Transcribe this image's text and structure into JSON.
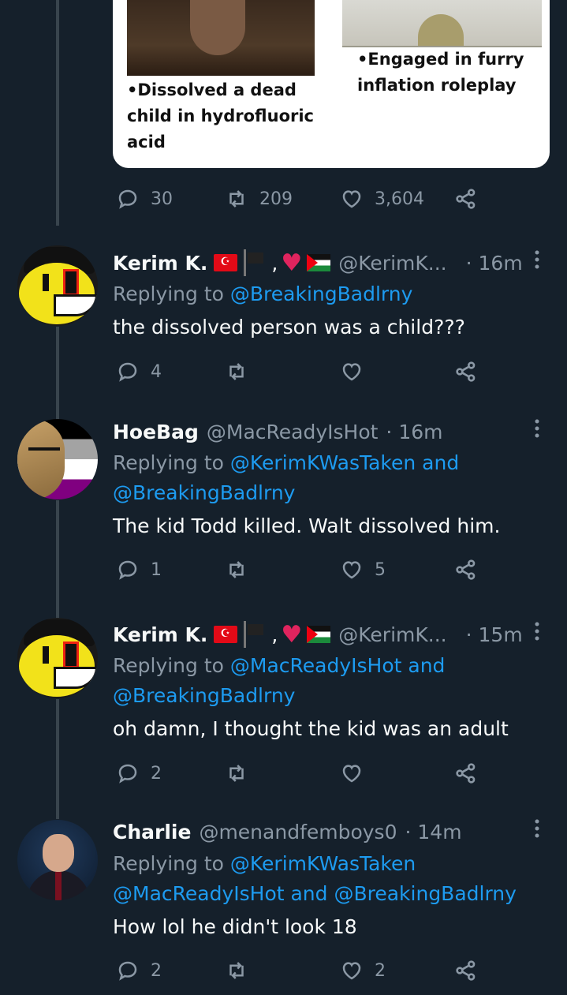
{
  "top_card": {
    "caption_left": "•Dissolved a dead child in hydrofluoric acid",
    "caption_right": "•Engaged in furry inflation roleplay"
  },
  "top_actions": {
    "replies": "30",
    "retweets": "209",
    "likes": "3,604"
  },
  "tweets": [
    {
      "name": "Kerim K.",
      "handle": "@KerimK...",
      "time": "· 16m",
      "replying_prefix": "Replying to ",
      "mentions": "@BreakingBadlrny",
      "text": "the dissolved person was a child???",
      "replies": "4",
      "retweets": "",
      "likes": ""
    },
    {
      "name": "HoeBag",
      "handle": "@MacReadyIsHot",
      "time": "· 16m",
      "replying_prefix": "Replying to ",
      "mentions": "@KerimKWasTaken and",
      "mentions2": "@BreakingBadlrny",
      "text": "The kid Todd killed. Walt dissolved him.",
      "replies": "1",
      "retweets": "",
      "likes": "5"
    },
    {
      "name": "Kerim K.",
      "handle": "@KerimK...",
      "time": "· 15m",
      "replying_prefix": "Replying to ",
      "mentions": "@MacReadyIsHot and",
      "mentions2": "@BreakingBadlrny",
      "text": "oh damn, I thought the kid was an adult",
      "replies": "2",
      "retweets": "",
      "likes": ""
    },
    {
      "name": "Charlie",
      "handle": "@menandfemboys0",
      "time": "· 14m",
      "replying_prefix": "Replying to ",
      "mentions": "@KerimKWasTaken",
      "mentions2": "@MacReadyIsHot and @BreakingBadlrny",
      "text": "How lol he didn't look 18",
      "replies": "2",
      "retweets": "",
      "likes": "2"
    }
  ],
  "colors": {
    "background": "#15202b",
    "accent": "#1d9bf0",
    "muted": "#8b98a5",
    "text": "#f7f9f9"
  }
}
